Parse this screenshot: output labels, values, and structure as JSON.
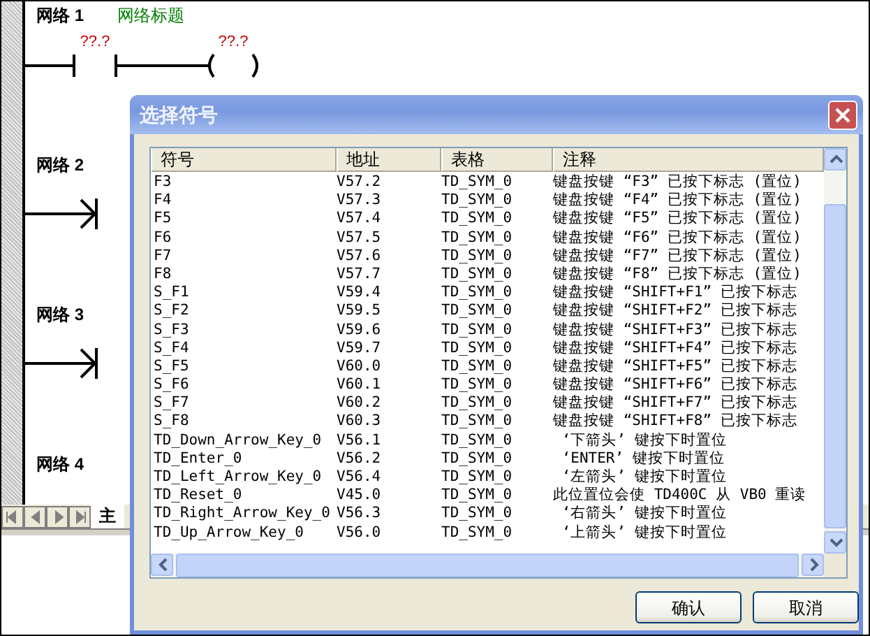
{
  "editor": {
    "networks": [
      {
        "kind": "contact-coil",
        "title": "网络 1",
        "comment": "网络标题",
        "contact_operand": "??.?",
        "coil_operand": "??.?"
      },
      {
        "kind": "stub",
        "title": "网络 2"
      },
      {
        "kind": "stub",
        "title": "网络 3"
      },
      {
        "kind": "partial",
        "title": "网络 4"
      }
    ],
    "tabs": [
      {
        "label": "主",
        "selected": true
      }
    ]
  },
  "dialog": {
    "title": "选择符号",
    "columns": [
      "符号",
      "地址",
      "表格",
      "注释"
    ],
    "rows": [
      {
        "symbol": "F3",
        "address": "V57.2",
        "table": "TD_SYM_0",
        "comment": "键盘按键 “F3” 已按下标志 (置位)"
      },
      {
        "symbol": "F4",
        "address": "V57.3",
        "table": "TD_SYM_0",
        "comment": "键盘按键 “F4” 已按下标志 (置位)"
      },
      {
        "symbol": "F5",
        "address": "V57.4",
        "table": "TD_SYM_0",
        "comment": "键盘按键 “F5” 已按下标志 (置位)"
      },
      {
        "symbol": "F6",
        "address": "V57.5",
        "table": "TD_SYM_0",
        "comment": "键盘按键 “F6” 已按下标志 (置位)"
      },
      {
        "symbol": "F7",
        "address": "V57.6",
        "table": "TD_SYM_0",
        "comment": "键盘按键 “F7” 已按下标志 (置位)"
      },
      {
        "symbol": "F8",
        "address": "V57.7",
        "table": "TD_SYM_0",
        "comment": "键盘按键 “F8” 已按下标志 (置位)"
      },
      {
        "symbol": "S_F1",
        "address": "V59.4",
        "table": "TD_SYM_0",
        "comment": "键盘按键 “SHIFT+F1” 已按下标志"
      },
      {
        "symbol": "S_F2",
        "address": "V59.5",
        "table": "TD_SYM_0",
        "comment": "键盘按键 “SHIFT+F2” 已按下标志"
      },
      {
        "symbol": "S_F3",
        "address": "V59.6",
        "table": "TD_SYM_0",
        "comment": "键盘按键 “SHIFT+F3” 已按下标志"
      },
      {
        "symbol": "S_F4",
        "address": "V59.7",
        "table": "TD_SYM_0",
        "comment": "键盘按键 “SHIFT+F4” 已按下标志"
      },
      {
        "symbol": "S_F5",
        "address": "V60.0",
        "table": "TD_SYM_0",
        "comment": "键盘按键 “SHIFT+F5” 已按下标志"
      },
      {
        "symbol": "S_F6",
        "address": "V60.1",
        "table": "TD_SYM_0",
        "comment": "键盘按键 “SHIFT+F6” 已按下标志"
      },
      {
        "symbol": "S_F7",
        "address": "V60.2",
        "table": "TD_SYM_0",
        "comment": "键盘按键 “SHIFT+F7” 已按下标志"
      },
      {
        "symbol": "S_F8",
        "address": "V60.3",
        "table": "TD_SYM_0",
        "comment": "键盘按键 “SHIFT+F8” 已按下标志"
      },
      {
        "symbol": "TD_Down_Arrow_Key_0",
        "address": "V56.1",
        "table": "TD_SYM_0",
        "comment": " ‘下箭头’ 键按下时置位"
      },
      {
        "symbol": "TD_Enter_0",
        "address": "V56.2",
        "table": "TD_SYM_0",
        "comment": " ‘ENTER’ 键按下时置位"
      },
      {
        "symbol": "TD_Left_Arrow_Key_0",
        "address": "V56.4",
        "table": "TD_SYM_0",
        "comment": " ‘左箭头’ 键按下时置位"
      },
      {
        "symbol": "TD_Reset_0",
        "address": "V45.0",
        "table": "TD_SYM_0",
        "comment": "此位置位会使 TD400C 从 VB0 重读"
      },
      {
        "symbol": "TD_Right_Arrow_Key_0",
        "address": "V56.3",
        "table": "TD_SYM_0",
        "comment": " ‘右箭头’ 键按下时置位"
      },
      {
        "symbol": "TD_Up_Arrow_Key_0",
        "address": "V56.0",
        "table": "TD_SYM_0",
        "comment": " ‘上箭头’ 键按下时置位"
      }
    ],
    "buttons": [
      "确认",
      "取消"
    ]
  }
}
